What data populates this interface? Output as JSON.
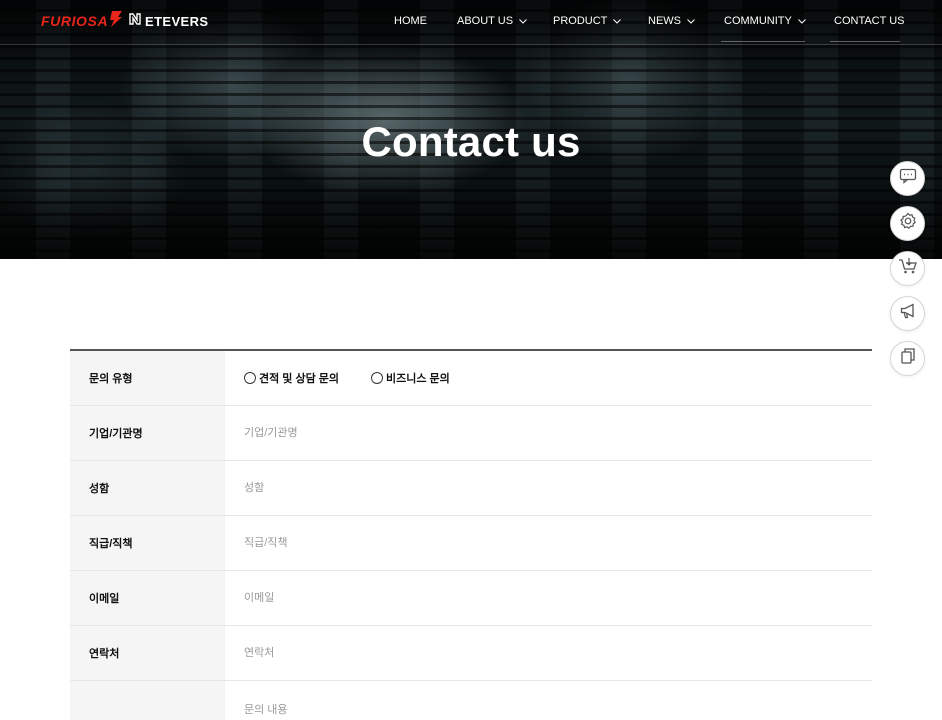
{
  "hero": {
    "title": "Contact us"
  },
  "brand": {
    "logo_left": "FURIOSA",
    "logo_right": "ETEVERS",
    "accent_color": "#e8261c"
  },
  "nav": {
    "items": [
      {
        "label": "HOME",
        "has_dropdown": false
      },
      {
        "label": "ABOUT US",
        "has_dropdown": true
      },
      {
        "label": "PRODUCT",
        "has_dropdown": true
      },
      {
        "label": "NEWS",
        "has_dropdown": true
      },
      {
        "label": "COMMUNITY",
        "has_dropdown": true
      },
      {
        "label": "CONTACT US",
        "has_dropdown": false
      }
    ]
  },
  "side_buttons": [
    {
      "icon": "chat-icon"
    },
    {
      "icon": "gear-icon"
    },
    {
      "icon": "cart-icon"
    },
    {
      "icon": "megaphone-icon"
    },
    {
      "icon": "copy-icon"
    }
  ],
  "form": {
    "inquiry_type": {
      "label": "문의 유형",
      "options": [
        "견적 및 상담 문의",
        "비즈니스 문의"
      ]
    },
    "company": {
      "label": "기업/기관명",
      "placeholder": "기업/기관명"
    },
    "name": {
      "label": "성함",
      "placeholder": "성함"
    },
    "position": {
      "label": "직급/직책",
      "placeholder": "직급/직책"
    },
    "email": {
      "label": "이메일",
      "placeholder": "이메일"
    },
    "phone": {
      "label": "연락처",
      "placeholder": "연락처"
    },
    "content": {
      "label": "",
      "placeholder": "문의 내용"
    }
  }
}
